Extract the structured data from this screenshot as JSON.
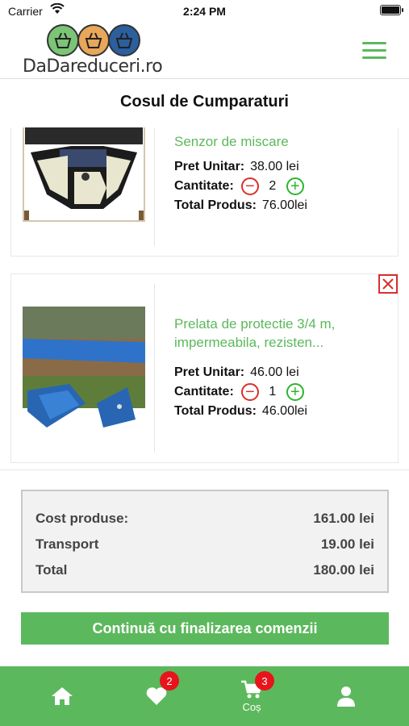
{
  "status": {
    "carrier": "Carrier",
    "time": "2:24 PM"
  },
  "header": {
    "logo_text": "DaDareduceri.ro"
  },
  "page": {
    "title": "Cosul de Cumparaturi"
  },
  "labels": {
    "unit_price": "Pret Unitar:",
    "quantity": "Cantitate:",
    "total": "Total Produs:"
  },
  "cart": {
    "items": [
      {
        "name": "Senzor de miscare",
        "unit_price": "38.00 lei",
        "quantity": "2",
        "total": "76.00lei"
      },
      {
        "name": "Prelata de protectie 3/4 m, impermeabila, rezisten...",
        "unit_price": "46.00 lei",
        "quantity": "1",
        "total": "46.00lei"
      }
    ]
  },
  "summary": {
    "cost_label": "Cost produse:",
    "cost_value": "161.00 lei",
    "transport_label": "Transport",
    "transport_value": "19.00 lei",
    "total_label": "Total",
    "total_value": "180.00 lei"
  },
  "checkout": {
    "label": "Continuă cu finalizarea comenzii"
  },
  "tabbar": {
    "favorites_badge": "2",
    "cart_badge": "3",
    "cart_label": "Coș"
  },
  "colors": {
    "accent": "#5cb85c",
    "remove": "#d9302c",
    "plus": "#2db52d",
    "badge": "#e8141c"
  }
}
